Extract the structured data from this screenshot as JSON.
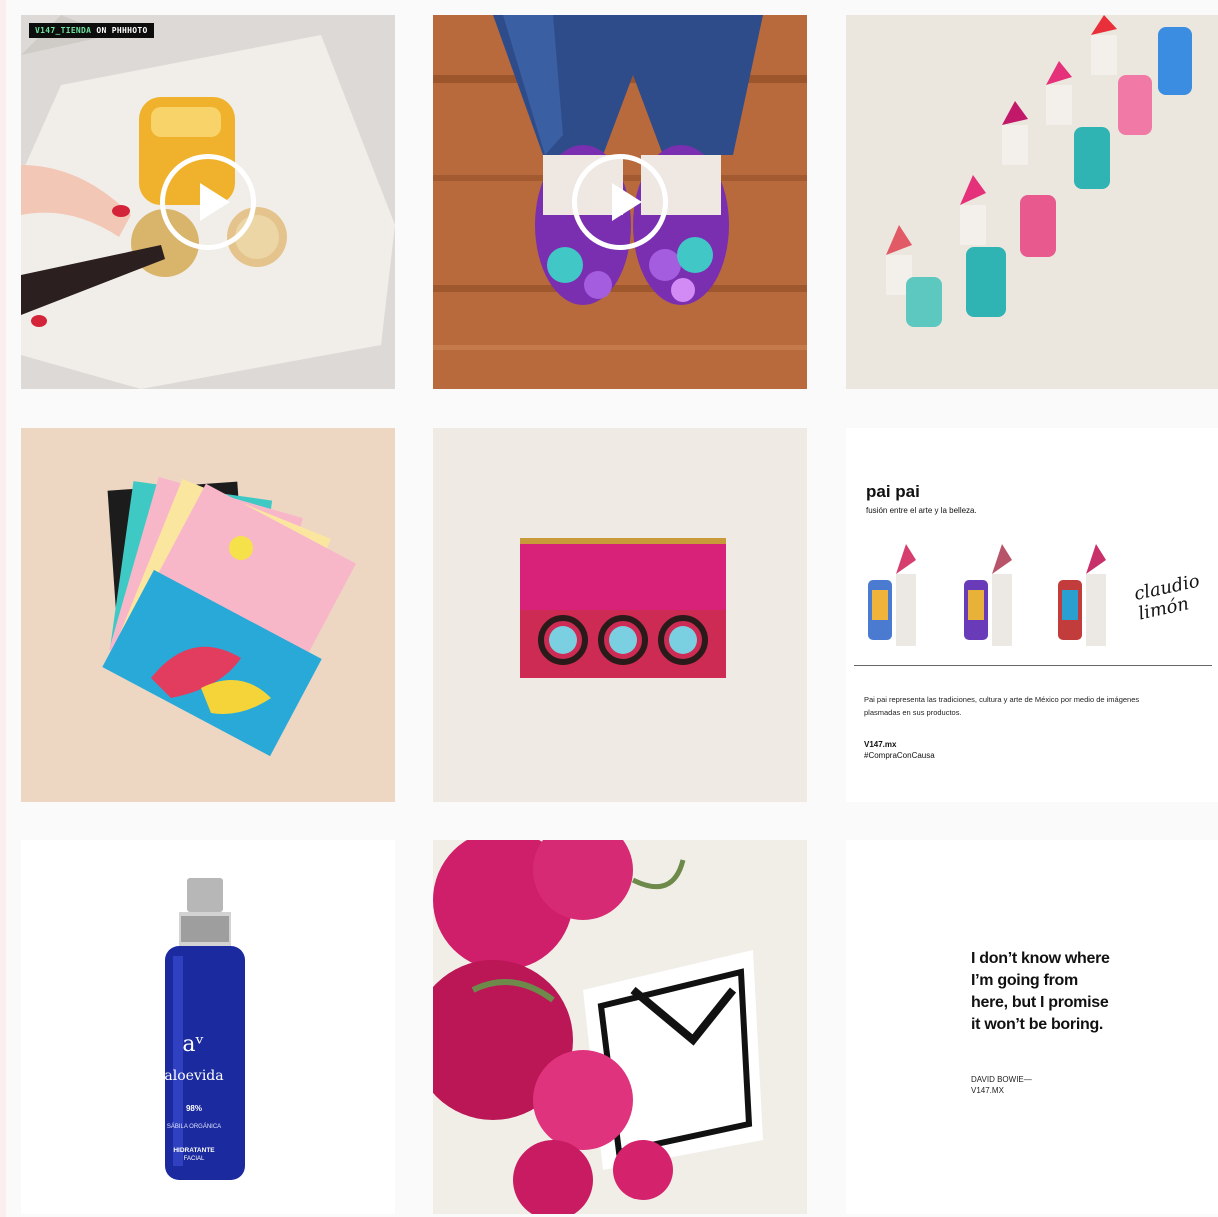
{
  "grid": {
    "tiles": [
      {
        "id": "post-1",
        "type": "video",
        "badge": "V147_TIENDA ON PHHHOTO",
        "badge_accent": "V147_TIENDA",
        "badge_rest": " ON PHHHOTO",
        "colors": {
          "bg": "#d9d6d3",
          "plate": "#f1eee9",
          "juice": "#f0b22c",
          "nail": "#d4243a"
        }
      },
      {
        "id": "post-2",
        "type": "video",
        "colors": {
          "bg": "#b86a3c",
          "jeans": "#2f4c8a",
          "shoe": "#7a2fb0",
          "flower": "#41c8c6"
        }
      },
      {
        "id": "post-3",
        "type": "image",
        "colors": {
          "bg": "#ebe6de",
          "lipstick": "#e5307a",
          "tube": "#2fb3b3"
        }
      },
      {
        "id": "post-4",
        "type": "image",
        "colors": {
          "bg": "#edd6c2",
          "card_pink": "#f8b7c9",
          "card_teal": "#3fc9c4"
        }
      },
      {
        "id": "post-5",
        "type": "image",
        "colors": {
          "bg": "#efebe4",
          "pouch": "#d8227a",
          "band": "#ce2b54"
        }
      },
      {
        "id": "post-6",
        "type": "image",
        "colors": {
          "bg": "#ffffff",
          "lipstick": "#d63e6e"
        }
      },
      {
        "id": "post-7",
        "type": "image",
        "colors": {
          "bg": "#ffffff",
          "bottle": "#1b2a9e",
          "cap": "#b7b7b7"
        }
      },
      {
        "id": "post-8",
        "type": "image",
        "colors": {
          "bg": "#f1eee8",
          "flower": "#cf1e6a",
          "card": "#ffffff"
        }
      },
      {
        "id": "post-9",
        "type": "image",
        "colors": {
          "bg": "#ffffff"
        }
      }
    ]
  },
  "paipai": {
    "brand": "pai pai",
    "tagline": "fusión entre el arte y la belleza.",
    "signature_line1": "claudio",
    "signature_line2": "limón",
    "description": "Pai pai representa las tradiciones, cultura y arte de México por medio de imágenes plasmadas en sus productos.",
    "url": "V147.mx",
    "hashtag": "#CompraConCausa"
  },
  "aloevida": {
    "monogram": "aᵛ",
    "name": "aloevida",
    "percent": "98%",
    "subtitle": "SÁBILA ORGÁNICA",
    "line1": "HIDRATANTE",
    "line2": "FACIAL"
  },
  "quote": {
    "text": "I don’t know where I’m going from here, but I promise it won’t be boring.",
    "author_line1": "DAVID BOWIE—",
    "author_line2": "V147.MX"
  }
}
